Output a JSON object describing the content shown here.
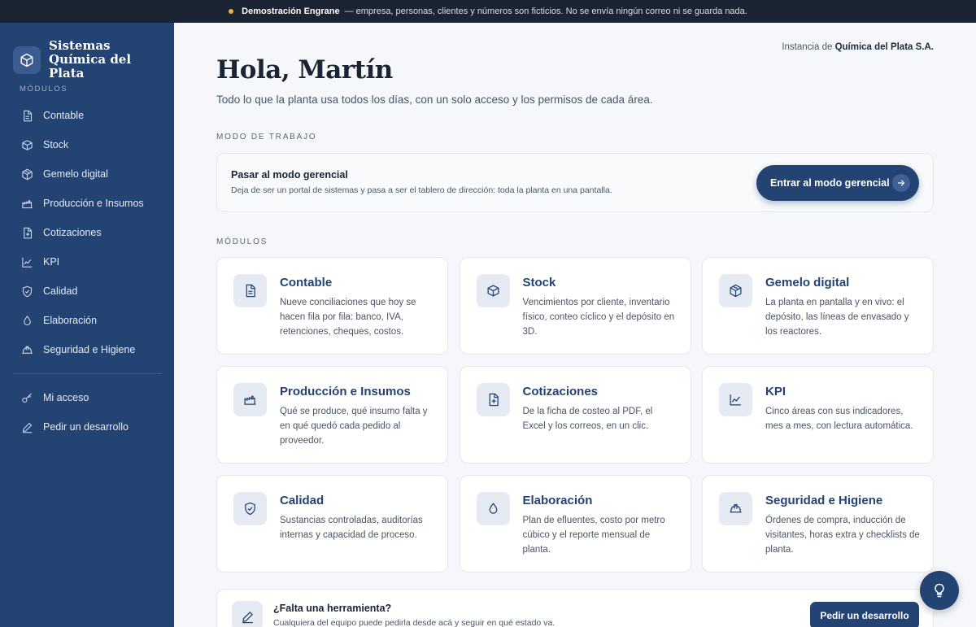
{
  "banner": {
    "strong": "Demostración Engrane",
    "text": "— empresa, personas, clientes y números son ficticios. No se envía ningún correo ni se guarda nada."
  },
  "brand": {
    "line1": "Sistemas",
    "line2": "Química del Plata"
  },
  "sidebar": {
    "section_label": "MÓDULOS",
    "items": [
      {
        "label": "Contable",
        "icon": "document-icon"
      },
      {
        "label": "Stock",
        "icon": "box-icon"
      },
      {
        "label": "Gemelo digital",
        "icon": "cube-icon"
      },
      {
        "label": "Producción e Insumos",
        "icon": "factory-icon"
      },
      {
        "label": "Cotizaciones",
        "icon": "document-plus-icon"
      },
      {
        "label": "KPI",
        "icon": "chart-line-icon"
      },
      {
        "label": "Calidad",
        "icon": "shield-check-icon"
      },
      {
        "label": "Elaboración",
        "icon": "drop-icon"
      },
      {
        "label": "Seguridad e Higiene",
        "icon": "hard-hat-icon"
      }
    ],
    "secondary": [
      {
        "label": "Mi acceso",
        "icon": "key-icon"
      },
      {
        "label": "Pedir un desarrollo",
        "icon": "pencil-icon"
      }
    ]
  },
  "header": {
    "instance_prefix": "Instancia de",
    "instance_name": "Química del Plata S.A.",
    "greeting": "Hola, Martín",
    "subtitle": "Todo lo que la planta usa todos los días, con un solo acceso y los permisos de cada área."
  },
  "mode": {
    "section_label": "MODO DE TRABAJO",
    "title": "Pasar al modo gerencial",
    "description": "Deja de ser un portal de sistemas y pasa a ser el tablero de dirección: toda la planta en una pantalla.",
    "button_label": "Entrar al modo gerencial"
  },
  "modules": {
    "section_label": "MÓDULOS",
    "cards": [
      {
        "title": "Contable",
        "description": "Nueve conciliaciones que hoy se hacen fila por fila: banco, IVA, retenciones, cheques, costos."
      },
      {
        "title": "Stock",
        "description": "Vencimientos por cliente, inventario físico, conteo cíclico y el depósito en 3D."
      },
      {
        "title": "Gemelo digital",
        "description": "La planta en pantalla y en vivo: el depósito, las líneas de envasado y los reactores."
      },
      {
        "title": "Producción e Insumos",
        "description": "Qué se produce, qué insumo falta y en qué quedó cada pedido al proveedor."
      },
      {
        "title": "Cotizaciones",
        "description": "De la ficha de costeo al PDF, el Excel y los correos, en un clic."
      },
      {
        "title": "KPI",
        "description": "Cinco áreas con sus indicadores, mes a mes, con lectura automática."
      },
      {
        "title": "Calidad",
        "description": "Sustancias controladas, auditorías internas y capacidad de proceso."
      },
      {
        "title": "Elaboración",
        "description": "Plan de efluentes, costo por metro cúbico y el reporte mensual de planta."
      },
      {
        "title": "Seguridad e Higiene",
        "description": "Órdenes de compra, inducción de visitantes, horas extra y checklists de planta."
      }
    ]
  },
  "tool_request": {
    "title": "¿Falta una herramienta?",
    "description": "Cualquiera del equipo puede pedirla desde acá y seguir en qué estado va.",
    "button_label": "Pedir un desarrollo"
  },
  "colors": {
    "sidebar": "#234373",
    "accent": "#234373",
    "banner": "#1b2433",
    "banner_dot": "#f2b233"
  }
}
